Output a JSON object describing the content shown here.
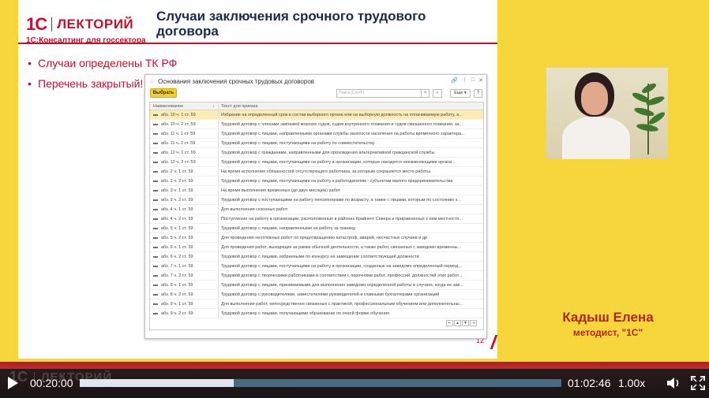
{
  "slide": {
    "logo": {
      "mark": "1С",
      "brand": "ЛЕКТОРИЙ",
      "subtitle": "1С:Консалтинг для госсектора"
    },
    "title": "Случаи заключения срочного трудового договора",
    "bullets": [
      "Случаи определены ТК РФ",
      "Перечень закрытый!"
    ],
    "page_number": "12"
  },
  "window": {
    "title": "Основания заключения срочных трудовых договоров",
    "select_button": "Выбрать",
    "search_placeholder": "Поиск (Ctrl+F)",
    "more_button": "Еще ▾",
    "help_button": "?",
    "columns": [
      "Наименование",
      "Текст для приказа"
    ],
    "rows": [
      {
        "name": "абз. 10 ч. 1 ст. 59",
        "text": "Избрание на определенный срок в состав выборного органа или на выборную должность на оплачиваемую работу, а..."
      },
      {
        "name": "абз. 10 ч. 2 ст. 59",
        "text": "Трудовой договор с членами экипажей морских судов, судов внутреннего плавания и судов смешанного плавания, за..."
      },
      {
        "name": "абз. 11 ч. 1 ст. 59",
        "text": "Трудовой договор с лицами, направленными органами службы занятости населения на работы временного характера..."
      },
      {
        "name": "абз. 11 ч. 2 ст. 59",
        "text": "Трудовой договор с лицами, поступающими на работу по совместительству"
      },
      {
        "name": "абз. 12 ч. 1 ст. 59",
        "text": "Трудовой договор с гражданами, направленными для прохождения альтернативной гражданской службы"
      },
      {
        "name": "абз. 12 ч. 2 ст. 59",
        "text": "Трудовой договор с лицами, поступающими на работу в организации, которые находятся неизменяющими органи..."
      },
      {
        "name": "абз. 2 ч. 1 ст. 59",
        "text": "На время исполнения обязанностей отсутствующего работника, за которым сохраняется место работы"
      },
      {
        "name": "абз. 2 ч. 2 ст. 59",
        "text": "Трудовой договор с лицами, поступающими на работу к работодателям - субъектам малого предпринимательства"
      },
      {
        "name": "абз. 3 ч. 1 ст. 59",
        "text": "На время выполнения временных (до двух месяцев) работ"
      },
      {
        "name": "абз. 3 ч. 2 ст. 59",
        "text": "Трудовой договор с поступающими на работу пенсионерами по возрасту, а также с лицами, которым по состоянию з..."
      },
      {
        "name": "абз. 4 ч. 1 ст. 59",
        "text": "Для выполнения сезонных работ"
      },
      {
        "name": "абз. 4 ч. 2 ст. 59",
        "text": "Поступление на работу в организации, расположенные в районах Крайнего Севера и приравненных к ним местностя..."
      },
      {
        "name": "абз. 5 ч. 1 ст. 59",
        "text": "Трудовой договор с лицами, направленными на работу за границу"
      },
      {
        "name": "абз. 5 ч. 2 ст. 59",
        "text": "Для проведения неотложных работ по предотвращению катастроф, аварий, несчастных случаев и др"
      },
      {
        "name": "абз. 6 ч. 1 ст. 59",
        "text": "Для проведения работ, выходящих за рамки обычной деятельности, а также работ, связанных с заведомо временны..."
      },
      {
        "name": "абз. 6 ч. 2 ст. 59",
        "text": "Трудовой договор с лицами, избранными по конкурсу на замещение соответствующей должности"
      },
      {
        "name": "абз. 7 ч. 1 ст. 59",
        "text": "Трудовой договор с лицами, поступающими на работу в организации, созданные на заведомо определенный период..."
      },
      {
        "name": "абз. 7 ч. 2 ст. 59",
        "text": "Трудовой договор с творческими работниками в соответствии с перечнями работ, профессий, должностей этих работ..."
      },
      {
        "name": "абз. 8 ч. 1 ст. 59",
        "text": "Трудовой договор с лицами, принимаемыми для выполнения заведомо определенной работы в случаях, когда ее зав..."
      },
      {
        "name": "абз. 8 ч. 2 ст. 59",
        "text": "Трудовой договор с руководителями, заместителями руководителей и главными бухгалтерами организаций"
      },
      {
        "name": "абз. 9 ч. 1 ст. 59",
        "text": "Для выполнения работ, непосредственно связанных с практикой, профессиональным обучением или дополнительны..."
      },
      {
        "name": "абз. 9 ч. 2 ст. 59",
        "text": "Трудовой договор с лицами, получающими образование по очной форме обучения"
      }
    ]
  },
  "speaker": {
    "name": "Кадыш Елена",
    "role": "методист, \"1С\""
  },
  "player": {
    "watermark_mark": "1С",
    "watermark_brand": "ЛЕКТОРИЙ",
    "current_time": "00:20:00",
    "total_time": "01:02:46",
    "progress_percent": 31.9,
    "speed": "1.00x"
  }
}
